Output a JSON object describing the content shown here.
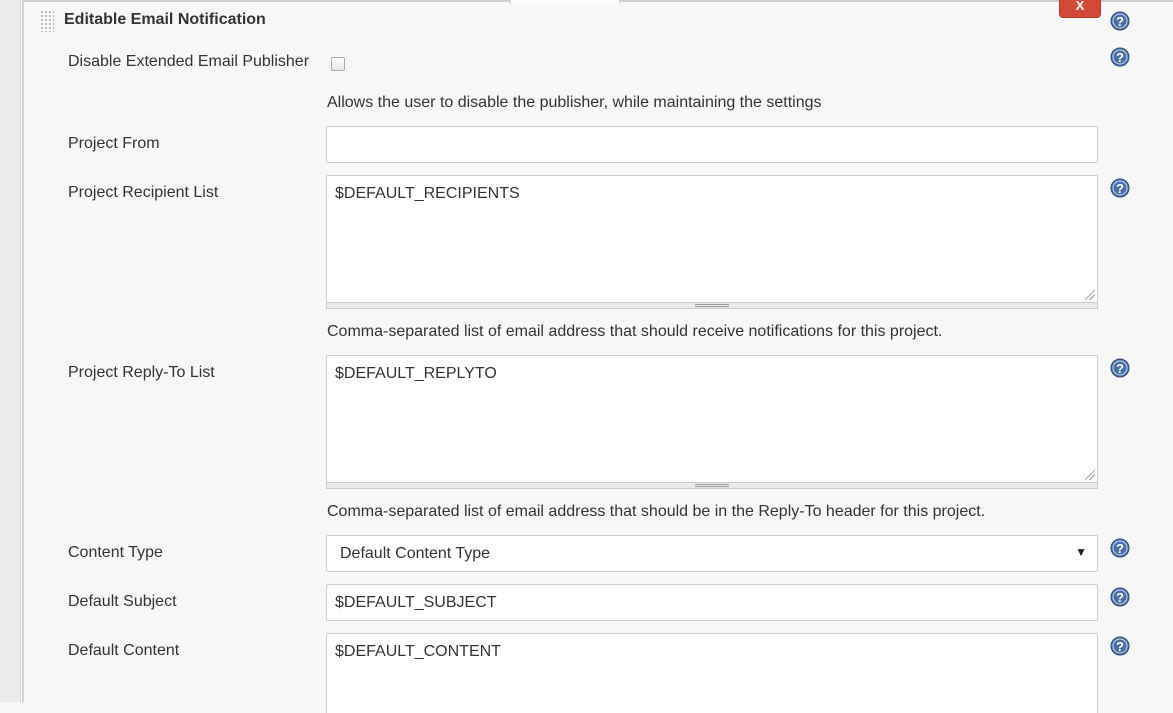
{
  "section": {
    "title": "Editable Email Notification",
    "delete_label": "X"
  },
  "fields": {
    "disable_publisher": {
      "label": "Disable Extended Email Publisher",
      "checked": false,
      "description": "Allows the user to disable the publisher, while maintaining the settings"
    },
    "project_from": {
      "label": "Project From",
      "value": ""
    },
    "recipient_list": {
      "label": "Project Recipient List",
      "value": "$DEFAULT_RECIPIENTS",
      "description": "Comma-separated list of email address that should receive notifications for this project."
    },
    "reply_to_list": {
      "label": "Project Reply-To List",
      "value": "$DEFAULT_REPLYTO",
      "description": "Comma-separated list of email address that should be in the Reply-To header for this project."
    },
    "content_type": {
      "label": "Content Type",
      "selected": "Default Content Type"
    },
    "default_subject": {
      "label": "Default Subject",
      "value": "$DEFAULT_SUBJECT"
    },
    "default_content": {
      "label": "Default Content",
      "value": "$DEFAULT_CONTENT"
    }
  },
  "icons": {
    "help": "help-icon",
    "grip": "drag-handle-icon",
    "dropdown": "dropdown-arrow-icon"
  },
  "colors": {
    "delete_button": "#d24939",
    "help_icon": "#4a6fa5",
    "background": "#f7f7f7"
  }
}
